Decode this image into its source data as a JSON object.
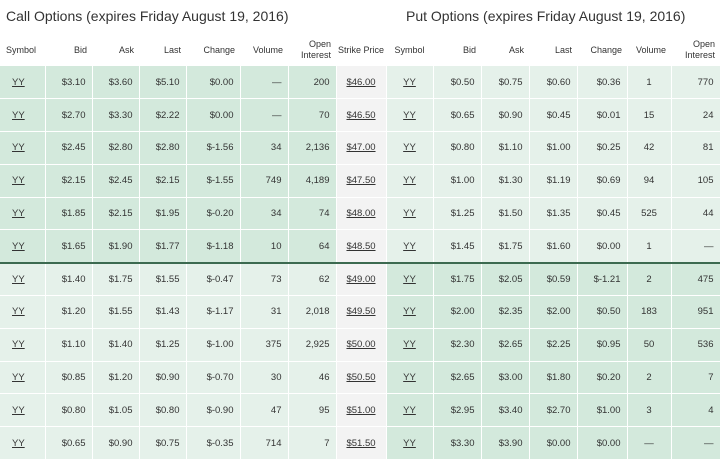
{
  "titles": {
    "call": "Call Options (expires Friday August 19, 2016)",
    "put": "Put Options (expires Friday August 19, 2016)"
  },
  "columns": {
    "call": [
      "Symbol",
      "Bid",
      "Ask",
      "Last",
      "Change",
      "Volume",
      "Open Interest"
    ],
    "strike": "Strike Price",
    "put": [
      "Symbol",
      "Bid",
      "Ask",
      "Last",
      "Change",
      "Volume",
      "Open Interest"
    ]
  },
  "rows": [
    {
      "call": {
        "symbol": "YY",
        "bid": "$3.10",
        "ask": "$3.60",
        "last": "$5.10",
        "change": "$0.00",
        "volume": "—",
        "oi": "200"
      },
      "strike": "$46.00",
      "put": {
        "symbol": "YY",
        "bid": "$0.50",
        "ask": "$0.75",
        "last": "$0.60",
        "change": "$0.36",
        "volume": "1",
        "oi": "770"
      }
    },
    {
      "call": {
        "symbol": "YY",
        "bid": "$2.70",
        "ask": "$3.30",
        "last": "$2.22",
        "change": "$0.00",
        "volume": "—",
        "oi": "70"
      },
      "strike": "$46.50",
      "put": {
        "symbol": "YY",
        "bid": "$0.65",
        "ask": "$0.90",
        "last": "$0.45",
        "change": "$0.01",
        "volume": "15",
        "oi": "24"
      }
    },
    {
      "call": {
        "symbol": "YY",
        "bid": "$2.45",
        "ask": "$2.80",
        "last": "$2.80",
        "change": "$-1.56",
        "volume": "34",
        "oi": "2,136"
      },
      "strike": "$47.00",
      "put": {
        "symbol": "YY",
        "bid": "$0.80",
        "ask": "$1.10",
        "last": "$1.00",
        "change": "$0.25",
        "volume": "42",
        "oi": "81"
      }
    },
    {
      "call": {
        "symbol": "YY",
        "bid": "$2.15",
        "ask": "$2.45",
        "last": "$2.15",
        "change": "$-1.55",
        "volume": "749",
        "oi": "4,189"
      },
      "strike": "$47.50",
      "put": {
        "symbol": "YY",
        "bid": "$1.00",
        "ask": "$1.30",
        "last": "$1.19",
        "change": "$0.69",
        "volume": "94",
        "oi": "105"
      }
    },
    {
      "call": {
        "symbol": "YY",
        "bid": "$1.85",
        "ask": "$2.15",
        "last": "$1.95",
        "change": "$-0.20",
        "volume": "34",
        "oi": "74"
      },
      "strike": "$48.00",
      "put": {
        "symbol": "YY",
        "bid": "$1.25",
        "ask": "$1.50",
        "last": "$1.35",
        "change": "$0.45",
        "volume": "525",
        "oi": "44"
      }
    },
    {
      "call": {
        "symbol": "YY",
        "bid": "$1.65",
        "ask": "$1.90",
        "last": "$1.77",
        "change": "$-1.18",
        "volume": "10",
        "oi": "64"
      },
      "strike": "$48.50",
      "put": {
        "symbol": "YY",
        "bid": "$1.45",
        "ask": "$1.75",
        "last": "$1.60",
        "change": "$0.00",
        "volume": "1",
        "oi": "—"
      }
    },
    {
      "call": {
        "symbol": "YY",
        "bid": "$1.40",
        "ask": "$1.75",
        "last": "$1.55",
        "change": "$-0.47",
        "volume": "73",
        "oi": "62"
      },
      "strike": "$49.00",
      "put": {
        "symbol": "YY",
        "bid": "$1.75",
        "ask": "$2.05",
        "last": "$0.59",
        "change": "$-1.21",
        "volume": "2",
        "oi": "475"
      }
    },
    {
      "call": {
        "symbol": "YY",
        "bid": "$1.20",
        "ask": "$1.55",
        "last": "$1.43",
        "change": "$-1.17",
        "volume": "31",
        "oi": "2,018"
      },
      "strike": "$49.50",
      "put": {
        "symbol": "YY",
        "bid": "$2.00",
        "ask": "$2.35",
        "last": "$2.00",
        "change": "$0.50",
        "volume": "183",
        "oi": "951"
      }
    },
    {
      "call": {
        "symbol": "YY",
        "bid": "$1.10",
        "ask": "$1.40",
        "last": "$1.25",
        "change": "$-1.00",
        "volume": "375",
        "oi": "2,925"
      },
      "strike": "$50.00",
      "put": {
        "symbol": "YY",
        "bid": "$2.30",
        "ask": "$2.65",
        "last": "$2.25",
        "change": "$0.95",
        "volume": "50",
        "oi": "536"
      }
    },
    {
      "call": {
        "symbol": "YY",
        "bid": "$0.85",
        "ask": "$1.20",
        "last": "$0.90",
        "change": "$-0.70",
        "volume": "30",
        "oi": "46"
      },
      "strike": "$50.50",
      "put": {
        "symbol": "YY",
        "bid": "$2.65",
        "ask": "$3.00",
        "last": "$1.80",
        "change": "$0.20",
        "volume": "2",
        "oi": "7"
      }
    },
    {
      "call": {
        "symbol": "YY",
        "bid": "$0.80",
        "ask": "$1.05",
        "last": "$0.80",
        "change": "$-0.90",
        "volume": "47",
        "oi": "95"
      },
      "strike": "$51.00",
      "put": {
        "symbol": "YY",
        "bid": "$2.95",
        "ask": "$3.40",
        "last": "$2.70",
        "change": "$1.00",
        "volume": "3",
        "oi": "4"
      }
    },
    {
      "call": {
        "symbol": "YY",
        "bid": "$0.65",
        "ask": "$0.90",
        "last": "$0.75",
        "change": "$-0.35",
        "volume": "714",
        "oi": "7"
      },
      "strike": "$51.50",
      "put": {
        "symbol": "YY",
        "bid": "$3.30",
        "ask": "$3.90",
        "last": "$0.00",
        "change": "$0.00",
        "volume": "—",
        "oi": "—"
      }
    }
  ],
  "colors": {
    "in_the_money": "#d3e9dc",
    "out_of_the_money": "#e5f1ea",
    "strike_column": "#f3f3f3",
    "separator": "#3c6a50"
  }
}
